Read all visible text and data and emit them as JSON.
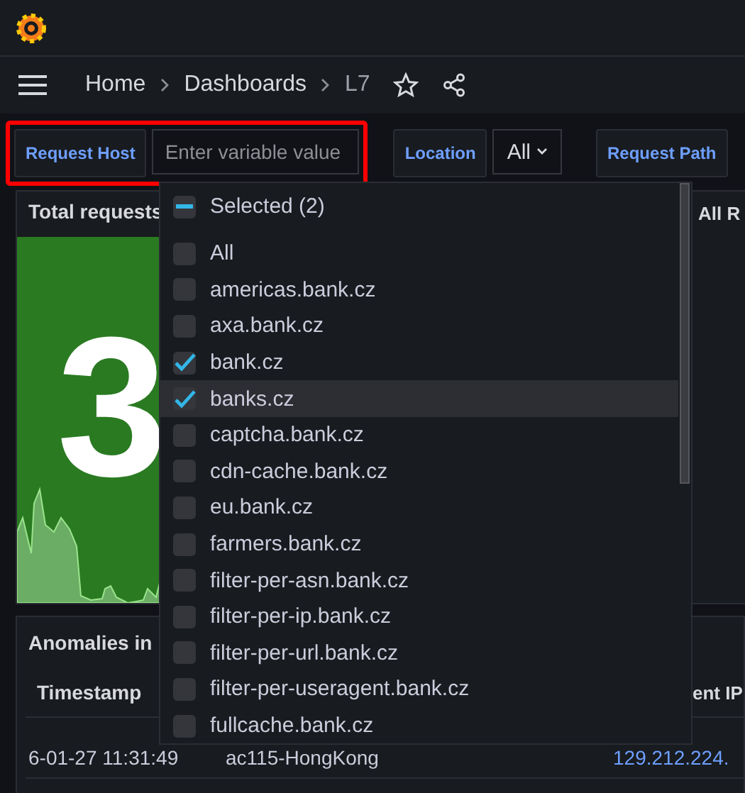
{
  "breadcrumbs": [
    {
      "label": "Home"
    },
    {
      "label": "Dashboards"
    },
    {
      "label": "L7"
    }
  ],
  "variables": [
    {
      "kind": "text",
      "label": "Request Host",
      "placeholder": "Enter variable value",
      "highlighted": true
    },
    {
      "kind": "select",
      "label": "Location",
      "value": "All",
      "highlighted": false
    },
    {
      "kind": "label",
      "label": "Request Path",
      "highlighted": false
    }
  ],
  "dropdown": {
    "summary": "Selected (2)",
    "partial": true,
    "options": [
      {
        "label": "All",
        "checked": false,
        "hovered": false
      },
      {
        "label": "americas.bank.cz",
        "checked": false,
        "hovered": false
      },
      {
        "label": "axa.bank.cz",
        "checked": false,
        "hovered": false
      },
      {
        "label": "bank.cz",
        "checked": true,
        "hovered": false
      },
      {
        "label": "banks.cz",
        "checked": true,
        "hovered": true
      },
      {
        "label": "captcha.bank.cz",
        "checked": false,
        "hovered": false
      },
      {
        "label": "cdn-cache.bank.cz",
        "checked": false,
        "hovered": false
      },
      {
        "label": "eu.bank.cz",
        "checked": false,
        "hovered": false
      },
      {
        "label": "farmers.bank.cz",
        "checked": false,
        "hovered": false
      },
      {
        "label": "filter-per-asn.bank.cz",
        "checked": false,
        "hovered": false
      },
      {
        "label": "filter-per-ip.bank.cz",
        "checked": false,
        "hovered": false
      },
      {
        "label": "filter-per-url.bank.cz",
        "checked": false,
        "hovered": false
      },
      {
        "label": "filter-per-useragent.bank.cz",
        "checked": false,
        "hovered": false
      },
      {
        "label": "fullcache.bank.cz",
        "checked": false,
        "hovered": false
      }
    ]
  },
  "stat_panel": {
    "title": "Total requests",
    "value": "3"
  },
  "side_panel": {
    "title": "All R"
  },
  "table": {
    "title": "Anomalies in",
    "columns": [
      "Timestamp",
      "",
      "ent IP"
    ],
    "rows": [
      [
        "6-01-27 11:31:49",
        "ac115-HongKong",
        "129.212.224."
      ]
    ]
  }
}
